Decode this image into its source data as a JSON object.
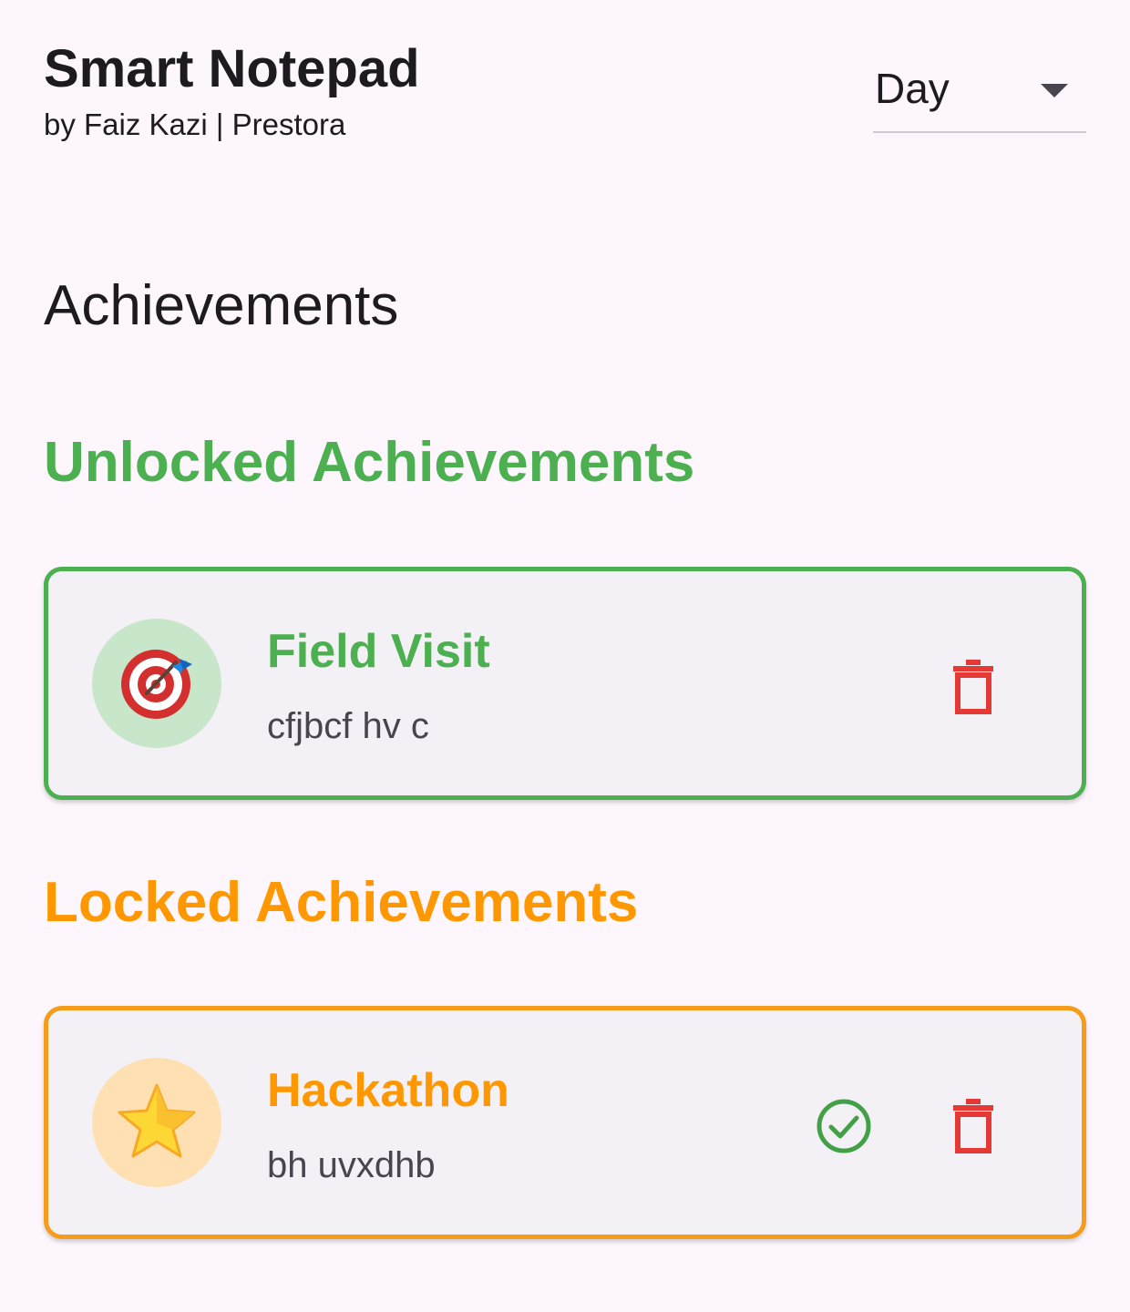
{
  "header": {
    "title": "Smart Notepad",
    "subtitle": "by Faiz Kazi | Prestora",
    "period_selector": {
      "value": "Day"
    }
  },
  "page": {
    "title": "Achievements"
  },
  "sections": {
    "unlocked": {
      "title": "Unlocked Achievements",
      "color": "#4caf50",
      "items": [
        {
          "title": "Field Visit",
          "description": "cfjbcf hv c",
          "icon": "target-dart-icon"
        }
      ]
    },
    "locked": {
      "title": "Locked Achievements",
      "color": "#ff9800",
      "items": [
        {
          "title": "Hackathon",
          "description": "bh uvxdhb",
          "icon": "star-icon"
        }
      ]
    }
  },
  "colors": {
    "delete": "#e53935",
    "complete": "#43a047",
    "background": "#fdf7fd",
    "card_background": "#f4f1f6"
  }
}
